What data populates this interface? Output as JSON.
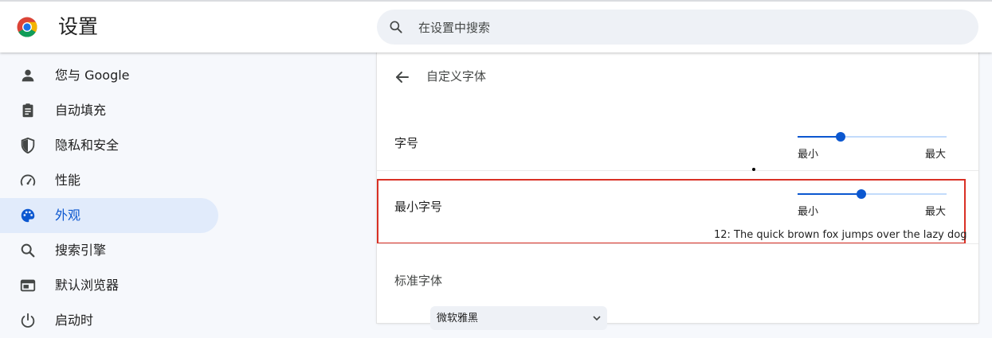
{
  "header": {
    "title": "设置",
    "search_placeholder": "在设置中搜索"
  },
  "sidebar": {
    "items": [
      {
        "label": "您与 Google",
        "icon": "person-icon"
      },
      {
        "label": "自动填充",
        "icon": "clipboard-icon"
      },
      {
        "label": "隐私和安全",
        "icon": "shield-icon"
      },
      {
        "label": "性能",
        "icon": "speedometer-icon"
      },
      {
        "label": "外观",
        "icon": "palette-icon",
        "active": true
      },
      {
        "label": "搜索引擎",
        "icon": "search-icon"
      },
      {
        "label": "默认浏览器",
        "icon": "browser-window-icon"
      },
      {
        "label": "启动时",
        "icon": "power-icon"
      }
    ]
  },
  "main": {
    "subpage_title": "自定义字体",
    "font_size": {
      "label": "字号",
      "min_label": "最小",
      "max_label": "最大",
      "level": 0.29
    },
    "min_font_size": {
      "label": "最小字号",
      "min_label": "最小",
      "max_label": "最大",
      "level": 0.43,
      "sample": "12: The quick brown fox jumps over the lazy dog"
    },
    "standard_font": {
      "title": "标准字体",
      "select_value": "微软雅黑"
    }
  },
  "colors": {
    "accent": "#0b57d0",
    "active_nav_bg": "#e1ebfb",
    "highlight_border": "#d93025"
  }
}
